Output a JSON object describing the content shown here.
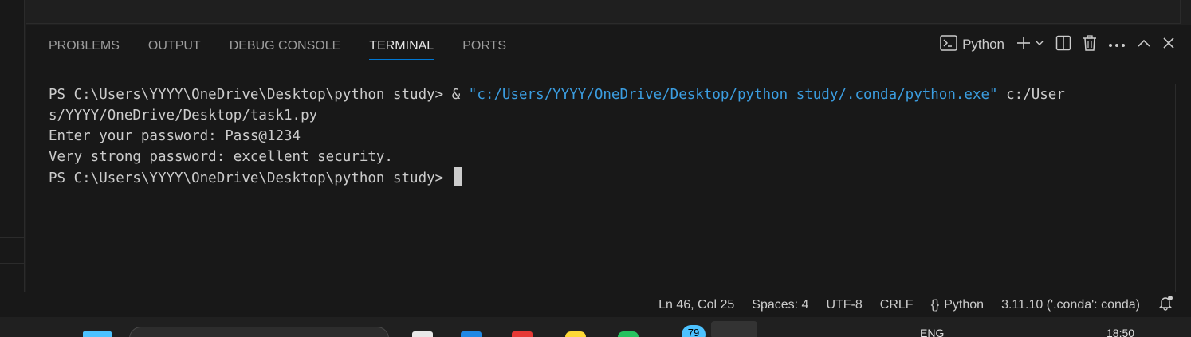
{
  "panel": {
    "tabs": [
      {
        "label": "PROBLEMS",
        "active": false
      },
      {
        "label": "OUTPUT",
        "active": false
      },
      {
        "label": "DEBUG CONSOLE",
        "active": false
      },
      {
        "label": "TERMINAL",
        "active": true
      },
      {
        "label": "PORTS",
        "active": false
      }
    ],
    "terminal_selector": "Python",
    "icons": [
      "terminal-icon",
      "plus-icon",
      "chevron-down-icon",
      "split-icon",
      "trash-icon",
      "more-icon",
      "chevron-up-icon",
      "close-icon"
    ]
  },
  "terminal": {
    "line1_prompt": "PS C:\\Users\\YYYY\\OneDrive\\Desktop\\python study> & ",
    "line1_string": "\"c:/Users/YYYY/OneDrive/Desktop/python study/.conda/python.exe\"",
    "line1_rest": " c:/User",
    "line2": "s/YYYY/OneDrive/Desktop/task1.py",
    "line3": "Enter your password: Pass@1234",
    "line4": "Very strong password: excellent security.",
    "line5_prompt": "PS C:\\Users\\YYYY\\OneDrive\\Desktop\\python study> "
  },
  "statusbar": {
    "position": "Ln 46, Col 25",
    "spaces": "Spaces: 4",
    "encoding": "UTF-8",
    "eol": "CRLF",
    "language": "Python",
    "language_icon": "{}",
    "interpreter": "3.11.10 ('.conda': conda)",
    "notification_icon": "bell-icon"
  },
  "taskbar": {
    "badge": "79",
    "language": "ENG",
    "time": "18:50"
  },
  "colors": {
    "accent": "#0078d4",
    "string": "#3b9de0",
    "background": "#181818"
  }
}
